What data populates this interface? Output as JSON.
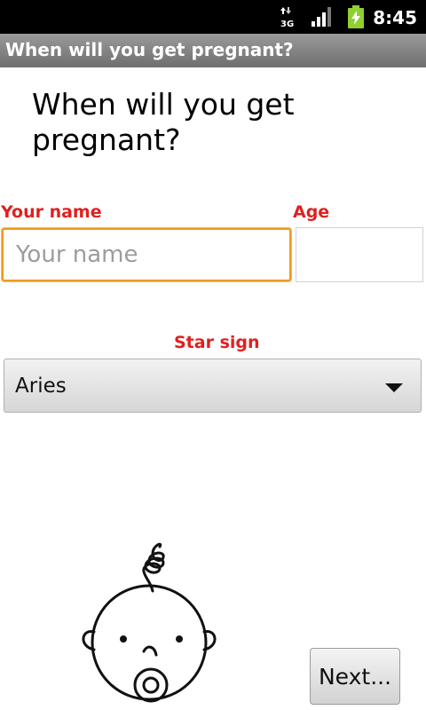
{
  "status_bar": {
    "time": "8:45",
    "network_label": "3G",
    "icons": [
      "network-3g-icon",
      "signal-strength-icon",
      "battery-charging-icon"
    ]
  },
  "app": {
    "title": "When will you get pregnant?"
  },
  "main": {
    "heading": "When will you get pregnant?",
    "name_label": "Your name",
    "name_placeholder": "Your name",
    "name_value": "",
    "age_label": "Age",
    "age_value": "",
    "star_sign_label": "Star sign",
    "star_sign_selected": "Aries",
    "next_button": "Next..."
  },
  "colors": {
    "label_red": "#e02020",
    "focus_orange": "#f09a1e",
    "titlebar_gray": "#808080"
  },
  "illustration": "baby-face-icon"
}
